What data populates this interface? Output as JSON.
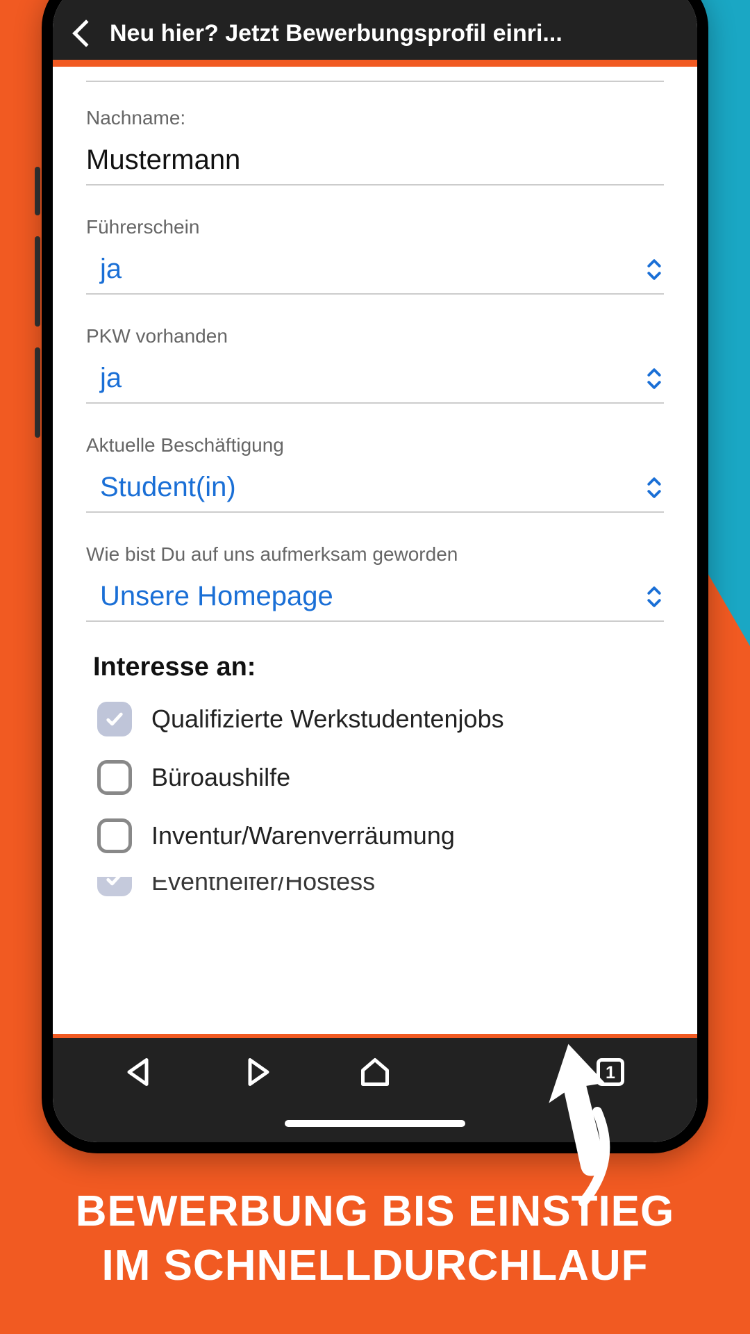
{
  "header": {
    "title": "Neu hier? Jetzt Bewerbungsprofil einri..."
  },
  "fields": {
    "lastname": {
      "label": "Nachname:",
      "value": "Mustermann"
    },
    "license": {
      "label": "Führerschein",
      "value": "ja"
    },
    "car": {
      "label": "PKW vorhanden",
      "value": "ja"
    },
    "employment": {
      "label": "Aktuelle Beschäftigung",
      "value": "Student(in)"
    },
    "referral": {
      "label": "Wie bist Du auf uns aufmerksam geworden",
      "value": "Unsere Homepage"
    }
  },
  "interest": {
    "title": "Interesse an:",
    "options": [
      {
        "label": "Qualifizierte Werkstudentenjobs",
        "checked": true
      },
      {
        "label": "Büroaushilfe",
        "checked": false
      },
      {
        "label": "Inventur/Warenverräumung",
        "checked": false
      },
      {
        "label": "Eventhelfer/Hostess",
        "checked": true
      }
    ]
  },
  "bottom_nav": {
    "tabs_count": "1"
  },
  "caption": {
    "line1": "BEWERBUNG BIS EINSTIEG",
    "line2": "IM SCHNELLDURCHLAUF"
  }
}
